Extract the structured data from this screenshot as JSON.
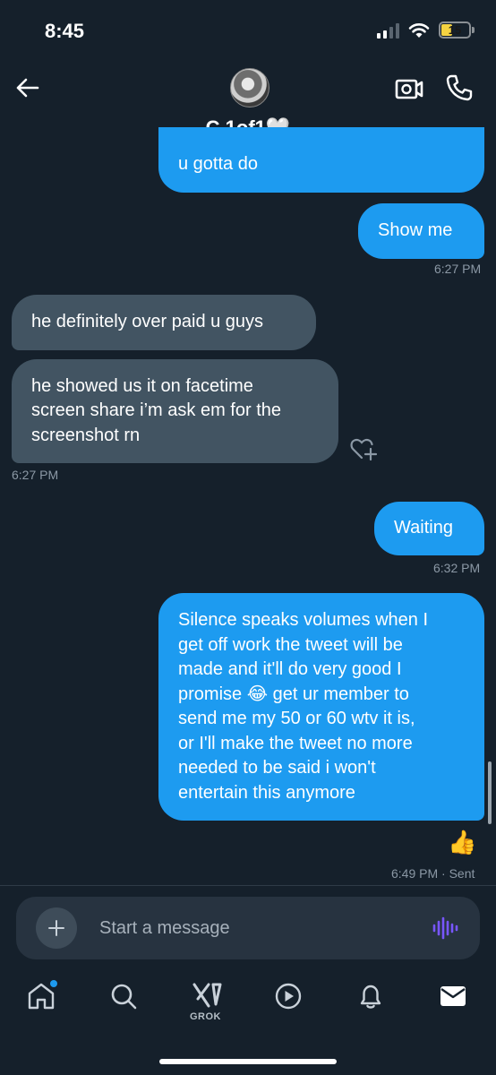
{
  "status_bar": {
    "time": "8:45",
    "battery": "15"
  },
  "header": {
    "contact_name": "C 1of1🤍"
  },
  "messages": {
    "m1": "u gotta do",
    "m2": "Show me",
    "ts1": "6:27 PM",
    "m3": "he definitely over paid u guys",
    "m4_line1": "he showed us it on facetime",
    "m4_line2": "screen share i’m ask em for the",
    "m4_line3": "screenshot rn",
    "ts2": "6:27 PM",
    "m5": "Waiting",
    "ts3": "6:32 PM",
    "m6_lines": [
      "Silence speaks volumes when I",
      "get off work the tweet will be",
      "made and it'll do very good I",
      "promise 😂 get ur member to",
      "send me my 50 or 60 wtv it is,",
      "or I'll make the tweet no more",
      "needed to be said i won't",
      "entertain this anymore"
    ],
    "reaction": "👍",
    "ts4": "6:49 PM · Sent"
  },
  "composer": {
    "placeholder": "Start a message"
  },
  "tabbar": {
    "grok_label": "GROK"
  },
  "colors": {
    "background": "#15202b",
    "sent_bubble": "#1d9bf0",
    "received_bubble": "#425462",
    "voice_icon": "#7856ff"
  },
  "icons": {
    "back": "back-arrow-icon",
    "video": "video-call-icon",
    "phone": "phone-icon",
    "react": "add-reaction-icon",
    "add": "plus-icon",
    "voice": "voice-wave-icon",
    "home": "home-icon",
    "search": "search-icon",
    "grok": "grok-icon",
    "video_tab": "play-icon",
    "notifications": "bell-icon",
    "messages": "mail-icon"
  }
}
